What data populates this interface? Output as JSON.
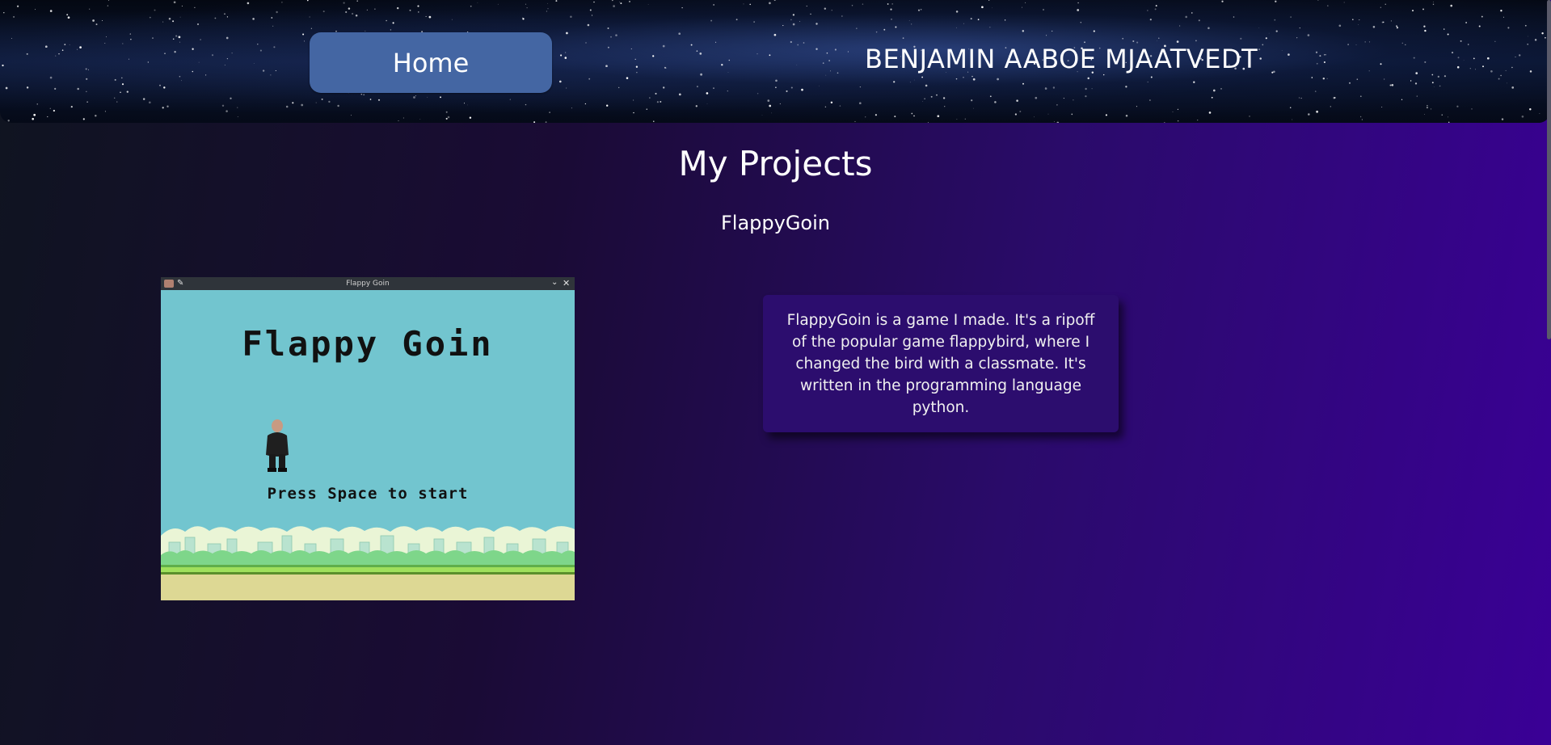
{
  "header": {
    "home_label": "Home",
    "site_title": "BENJAMIN AABOE MJAATVEDT"
  },
  "main": {
    "heading": "My Projects",
    "project": {
      "title": "FlappyGoin",
      "screenshot": {
        "window_title": "Flappy Goin",
        "game_title": "Flappy Goin",
        "start_prompt": "Press Space to start"
      },
      "description": "FlappyGoin is a game I made. It's a ripoff of the popular game flappybird, where I changed the bird with a classmate. It's written in the programming language python."
    }
  },
  "colors": {
    "home_button": "#4466a3",
    "card_background": "#2c0d6e",
    "game_sky": "#72c5cf",
    "game_ground": "#ddd894"
  },
  "icons": {
    "window_app": "app-icon",
    "window_pin": "pin-icon",
    "window_minimize": "chevron-down-icon",
    "window_close": "close-icon"
  }
}
